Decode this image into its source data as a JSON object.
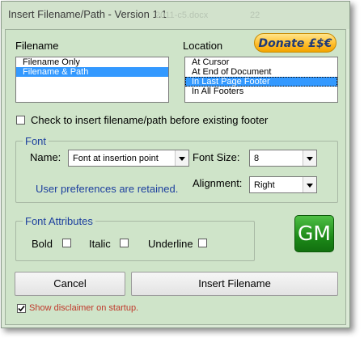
{
  "window": {
    "title": "Insert Filename/Path - Version 1.1"
  },
  "ghost_texts": [
    "2011-c5.docx",
    "22"
  ],
  "filename": {
    "label": "Filename",
    "items": [
      "Filename Only",
      "Filename & Path"
    ],
    "selected": "Filename & Path"
  },
  "location": {
    "label": "Location",
    "items": [
      "At Cursor",
      "At End of Document",
      "In Last Page Footer",
      "In All Footers"
    ],
    "selected": "In Last Page Footer"
  },
  "donate": {
    "label": "Donate £$€"
  },
  "before_footer": {
    "label": "Check to insert filename/path before existing footer",
    "checked": false
  },
  "font": {
    "legend": "Font",
    "name_label": "Name:",
    "name_value": "Font at insertion point",
    "size_label": "Font Size:",
    "size_value": "8",
    "alignment_label": "Alignment:",
    "alignment_value": "Right",
    "prefs_note": "User preferences are retained."
  },
  "attributes": {
    "legend": "Font Attributes",
    "bold": "Bold",
    "italic": "Italic",
    "underline": "Underline"
  },
  "logo": {
    "text": "GM"
  },
  "buttons": {
    "cancel": "Cancel",
    "insert": "Insert Filename"
  },
  "disclaimer": {
    "label": "Show disclaimer on startup.",
    "checked": true
  },
  "colors": {
    "background": "#cfe4c9",
    "accent_text": "#1c3f9e",
    "disclaimer_text": "#c0392b",
    "selection": "#3399ff"
  }
}
